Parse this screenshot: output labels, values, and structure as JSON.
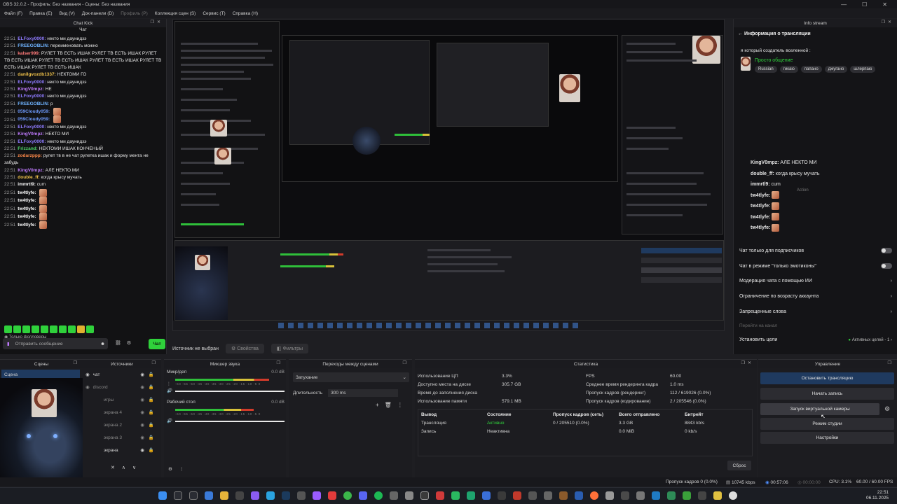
{
  "window": {
    "title": "OBS 32.0.2 - Профиль: Без названия - Сцены: Без названия"
  },
  "menu": {
    "items": [
      "Файл (F)",
      "Правка (E)",
      "Вид (V)",
      "Док-панели (D)",
      "Профиль (P)",
      "Коллекция сцен (S)",
      "Сервис (T)",
      "Справка (H)"
    ],
    "disabled_index": 4
  },
  "chat_dock": {
    "title": "Chat Kick",
    "subtitle": "Чат",
    "messages": [
      {
        "time": "22:51",
        "user": "ELFoxy0000:",
        "text": "некто ми даунидзэ",
        "color": "#8f7bff"
      },
      {
        "time": "22:51",
        "user": "FREEGOBLIN:",
        "text": "переименовать можно",
        "color": "#6fb3ff"
      },
      {
        "time": "22:51",
        "user": "kalser999:",
        "text": "РУЛЕТ ТВ ЕСТЬ ИШАК РУЛЕТ ТВ ЕСТЬ ИШАК РУЛЕТ ТВ ЕСТЬ ИШАК РУЛЕТ ТВ ЕСТЬ ИШАК РУЛЕТ ТВ ЕСТЬ ИШАК РУЛЕТ ТВ ЕСТЬ ИШАК РУЛЕТ ТВ ЕСТЬ ИШАК",
        "color": "#ff7a7a"
      },
      {
        "time": "22:51",
        "user": "danilgvozdb1337:",
        "text": "НЕКТОМИ ГО",
        "color": "#f0c24a"
      },
      {
        "time": "22:51",
        "user": "ELFoxy0000:",
        "text": "некто ми даунидзэ",
        "color": "#8f7bff"
      },
      {
        "time": "22:51",
        "user": "KingV0mpz:",
        "text": "НЕ",
        "color": "#c07bff"
      },
      {
        "time": "22:51",
        "user": "ELFoxy0000:",
        "text": "некто ми даунидзэ",
        "color": "#8f7bff"
      },
      {
        "time": "22:51",
        "user": "FREEGOBLIN:",
        "text": "р",
        "color": "#6fb3ff"
      },
      {
        "time": "22:51",
        "user": "059Cloudy059:",
        "text": "",
        "color": "#6f9bff"
      },
      {
        "time": "22:51",
        "user": "059Cloudy059:",
        "text": "",
        "color": "#6f9bff"
      },
      {
        "time": "22:51",
        "user": "ELFoxy0000:",
        "text": "некто ми даунидзэ",
        "color": "#8f7bff"
      },
      {
        "time": "22:51",
        "user": "KingV0mpz:",
        "text": "НЕКТО МИ",
        "color": "#c07bff"
      },
      {
        "time": "22:51",
        "user": "ELFoxy0000:",
        "text": "некто ми даунидзэ",
        "color": "#8f7bff"
      },
      {
        "time": "22:51",
        "user": "Frizzand:",
        "text": "НЕКТОМИ ИШАК КОНЧЕНЫЙ",
        "color": "#4fd66a"
      },
      {
        "time": "22:51",
        "user": "zodarzppp:",
        "text": "рулет тв в не чат рулетка ишак и форму мента не забудь",
        "color": "#ff8a4a"
      },
      {
        "time": "22:51",
        "user": "KingV0mpz:",
        "text": "АЛЕ НЕКТО МИ",
        "color": "#c07bff"
      },
      {
        "time": "22:51",
        "user": "double_ff:",
        "text": "когда крысу мучать",
        "color": "#f0c24a"
      },
      {
        "time": "22:51",
        "user": "immrtl9:",
        "text": "cum",
        "color": "#ffffff"
      },
      {
        "time": "22:51",
        "user": "tw4tlyfe:",
        "text": "",
        "color": "#ffffff"
      },
      {
        "time": "22:51",
        "user": "tw4tlyfe:",
        "text": "",
        "color": "#ffffff"
      },
      {
        "time": "22:51",
        "user": "tw4tlyfe:",
        "text": "",
        "color": "#ffffff"
      },
      {
        "time": "22:51",
        "user": "tw4tlyfe:",
        "text": "",
        "color": "#ffffff"
      },
      {
        "time": "22:51",
        "user": "tw4tlyfe:",
        "text": "",
        "color": "#ffffff"
      }
    ],
    "followers_only": "Только фолловеры",
    "input_placeholder": "Отправить сообщение",
    "send_label": "Чат"
  },
  "source_bar": {
    "no_source": "Источник не выбран",
    "properties": "Свойства",
    "filters": "Фильтры"
  },
  "info_dock": {
    "title": "Info stream",
    "header": "Информация о трансляции",
    "stream_title": "я который создатель вселенной :",
    "category": "Просто общение",
    "tags": [
      "Russian",
      "гикаю",
      "папано",
      "джугано",
      "шлерпаю"
    ],
    "overlay_chat": [
      {
        "user": "KingV0mpz:",
        "text": "АЛЕ НЕКТО МИ"
      },
      {
        "user": "double_ff:",
        "text": "когда крысу мучать"
      },
      {
        "user": "immrtl9:",
        "text": "cum"
      },
      {
        "user": "tw4tlyfe:",
        "text": ""
      },
      {
        "user": "tw4tlyfe:",
        "text": ""
      },
      {
        "user": "tw4tlyfe:",
        "text": ""
      },
      {
        "user": "tw4tlyfe:",
        "text": ""
      }
    ],
    "action_label": "Action",
    "settings": {
      "subs_only": "Чат только для подписчиков",
      "emotes_only": "Чат в режиме \"только эмотиконы\"",
      "ai_mod": "Модерация чата с помощью ИИ",
      "age_limit": "Ограничение по возрасту аккаунта",
      "banned_words": "Запрещенные слова",
      "raid": "Перейти на канал",
      "goals": "Установить цели",
      "goals_status": "Активных целей - 1"
    }
  },
  "scenes": {
    "title": "Сцены",
    "items": [
      "Сцена"
    ]
  },
  "sources": {
    "title": "Источники",
    "items": [
      "чат",
      "discord",
      "игры",
      "экрана 4",
      "экрана 2",
      "экрана 3",
      "экрана"
    ]
  },
  "mixer": {
    "title": "Микшер звука",
    "channels": [
      {
        "name": "Микр/деп",
        "db": "0.0 dB",
        "level": 0.86
      },
      {
        "name": "Рабочий стол",
        "db": "0.0 dB",
        "level": 0.72
      }
    ],
    "ticks": "-60 -55 -50 -45 -40 -35 -30 -25 -20 -15 -10 -5 0"
  },
  "transitions": {
    "title": "Переходы между сценами",
    "selected": "Затухание",
    "duration_label": "Длительность",
    "duration_value": "300 ms"
  },
  "stats": {
    "title": "Статистика",
    "left": [
      {
        "label": "Использование ЦП",
        "value": "3.3%"
      },
      {
        "label": "Доступно места на диске",
        "value": "305.7 GB"
      },
      {
        "label": "Время до заполнения диска",
        "value": ""
      },
      {
        "label": "Использование памяти",
        "value": "579.1 MB"
      }
    ],
    "right": [
      {
        "label": "FPS",
        "value": "60.00"
      },
      {
        "label": "Среднее время рендеринга кадра",
        "value": "1.0 ms"
      },
      {
        "label": "Пропуск кадров (рендеринг)",
        "value": "112 / 619026 (0.0%)"
      },
      {
        "label": "Пропуск кадров (кодирование)",
        "value": "2 / 205546 (0.0%)"
      }
    ],
    "table_headers": [
      "Вывод",
      "Состояние",
      "Пропуск кадров (сеть)",
      "Всего отправлено",
      "Битрейт"
    ],
    "table_rows": [
      [
        "Трансляция",
        "Активно",
        "0 / 205510 (0.0%)",
        "3.3 GB",
        "8843 kb/s"
      ],
      [
        "Запись",
        "Неактивна",
        "",
        "0.0 MiB",
        "0 kb/s"
      ]
    ],
    "reset_label": "Сброс"
  },
  "controls": {
    "title": "Управление",
    "buttons": [
      "Остановить трансляцию",
      "Начать запись",
      "Запуск виртуальной камеры",
      "Режим студии",
      "Настройки"
    ]
  },
  "status_bar": {
    "dropped": "Пропуск кадров 0 (0.0%)",
    "bitrate": "10745 kbps",
    "stream_time": "00:57:06",
    "rec_time": "00:00:00",
    "cpu": "CPU: 3.1%",
    "fps": "60.00 / 60.00 FPS"
  },
  "taskbar": {
    "time": "22:51",
    "date": "06.11.2025"
  },
  "colors": {
    "accent_green": "#2fd13b",
    "active_button": "#1f3a5f",
    "bg": "#1e1e22"
  }
}
